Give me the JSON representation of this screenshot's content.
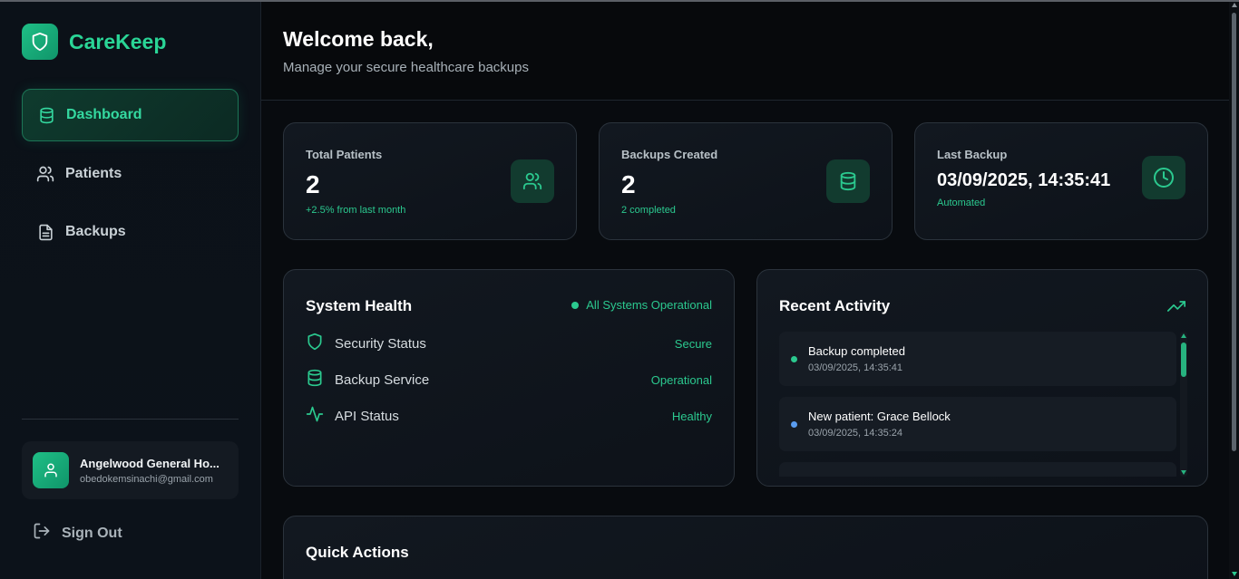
{
  "brand": {
    "name": "CareKeep",
    "logo_icon": "shield-icon",
    "accent": "#2ad596"
  },
  "sidebar": {
    "items": [
      {
        "label": "Dashboard",
        "icon": "database-icon",
        "active": true
      },
      {
        "label": "Patients",
        "icon": "users-icon",
        "active": false
      },
      {
        "label": "Backups",
        "icon": "file-icon",
        "active": false
      }
    ],
    "user": {
      "name": "Angelwood General Ho...",
      "email": "obedokemsinachi@gmail.com",
      "icon": "user-icon"
    },
    "signout_label": "Sign Out"
  },
  "header": {
    "title": "Welcome back,",
    "subtitle": "Manage your secure healthcare backups"
  },
  "stats": [
    {
      "label": "Total Patients",
      "value": "2",
      "note": "+2.5% from last month",
      "icon": "users-icon"
    },
    {
      "label": "Backups Created",
      "value": "2",
      "note": "2 completed",
      "icon": "database-icon"
    },
    {
      "label": "Last Backup",
      "value": "03/09/2025, 14:35:41",
      "note": "Automated",
      "icon": "clock-icon"
    }
  ],
  "system_health": {
    "title": "System Health",
    "overall": "All Systems Operational",
    "rows": [
      {
        "label": "Security Status",
        "value": "Secure",
        "icon": "shield-icon"
      },
      {
        "label": "Backup Service",
        "value": "Operational",
        "icon": "database-icon"
      },
      {
        "label": "API Status",
        "value": "Healthy",
        "icon": "activity-icon"
      }
    ]
  },
  "recent_activity": {
    "title": "Recent Activity",
    "icon": "trending-up-icon",
    "items": [
      {
        "title": "Backup completed",
        "time": "03/09/2025, 14:35:41",
        "dot_color": "#2bc98f"
      },
      {
        "title": "New patient: Grace Bellock",
        "time": "03/09/2025, 14:35:24",
        "dot_color": "#5a9cf0"
      },
      {
        "title": "",
        "time": "",
        "dot_color": "#5a9cf0"
      }
    ]
  },
  "quick_actions": {
    "title": "Quick Actions"
  },
  "colors": {
    "accent_green": "#2bc98f",
    "info_blue": "#5a9cf0",
    "background": "#080b0f"
  }
}
